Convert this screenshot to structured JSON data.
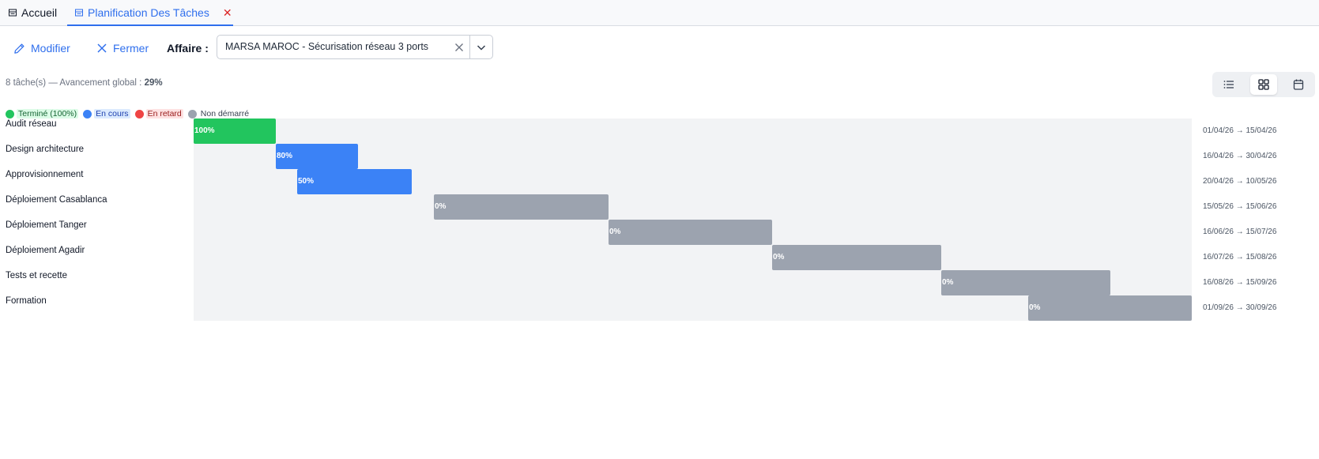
{
  "tabs": [
    {
      "label": "Accueil",
      "active": false
    },
    {
      "label": "Planification Des Tâches",
      "active": true,
      "close": "✕"
    }
  ],
  "toolbar": {
    "edit_label": "Modifier",
    "close_label": "Fermer",
    "affaire_label": "Affaire :",
    "affaire_value": "MARSA MAROC - Sécurisation réseau 3 ports"
  },
  "summary": {
    "prefix": "8 tâche(s) — Avancement global : ",
    "percent": "29%"
  },
  "view_switch": {
    "active": "grid",
    "options": [
      "list-icon",
      "grid-icon",
      "calendar-icon"
    ]
  },
  "legend": [
    {
      "label": "Terminé (100%)",
      "color": "#22c55e"
    },
    {
      "label": "En cours",
      "color": "#3b82f6"
    },
    {
      "label": "En retard",
      "color": "#ef4444"
    },
    {
      "label": "Non démarré",
      "color": "#9ca3af"
    }
  ],
  "colors": {
    "accent": "#2f6fed",
    "done": "#22c55e",
    "in_progress": "#3b82f6",
    "late": "#ef4444",
    "not_started": "#9ca3af"
  },
  "timeline": {
    "start": "2026-04-01",
    "end": "2026-09-30"
  },
  "tasks": [
    {
      "name": "Audit réseau",
      "start": "2026-04-01",
      "end": "2026-04-15",
      "progress": "100%",
      "status": "done",
      "dates": "01/04/26 → 15/04/26"
    },
    {
      "name": "Design architecture",
      "start": "2026-04-16",
      "end": "2026-04-30",
      "progress": "80%",
      "status": "in_progress",
      "dates": "16/04/26 → 30/04/26"
    },
    {
      "name": "Approvisionnement",
      "start": "2026-04-20",
      "end": "2026-05-10",
      "progress": "50%",
      "status": "in_progress",
      "dates": "20/04/26 → 10/05/26"
    },
    {
      "name": "Déploiement Casablanca",
      "start": "2026-05-15",
      "end": "2026-06-15",
      "progress": "0%",
      "status": "not_started",
      "dates": "15/05/26 → 15/06/26"
    },
    {
      "name": "Déploiement Tanger",
      "start": "2026-06-16",
      "end": "2026-07-15",
      "progress": "0%",
      "status": "not_started",
      "dates": "16/06/26 → 15/07/26"
    },
    {
      "name": "Déploiement Agadir",
      "start": "2026-07-16",
      "end": "2026-08-15",
      "progress": "0%",
      "status": "not_started",
      "dates": "16/07/26 → 15/08/26"
    },
    {
      "name": "Tests et recette",
      "start": "2026-08-16",
      "end": "2026-09-15",
      "progress": "0%",
      "status": "not_started",
      "dates": "16/08/26 → 15/09/26"
    },
    {
      "name": "Formation",
      "start": "2026-09-01",
      "end": "2026-09-30",
      "progress": "0%",
      "status": "not_started",
      "dates": "01/09/26 → 30/09/26"
    }
  ]
}
